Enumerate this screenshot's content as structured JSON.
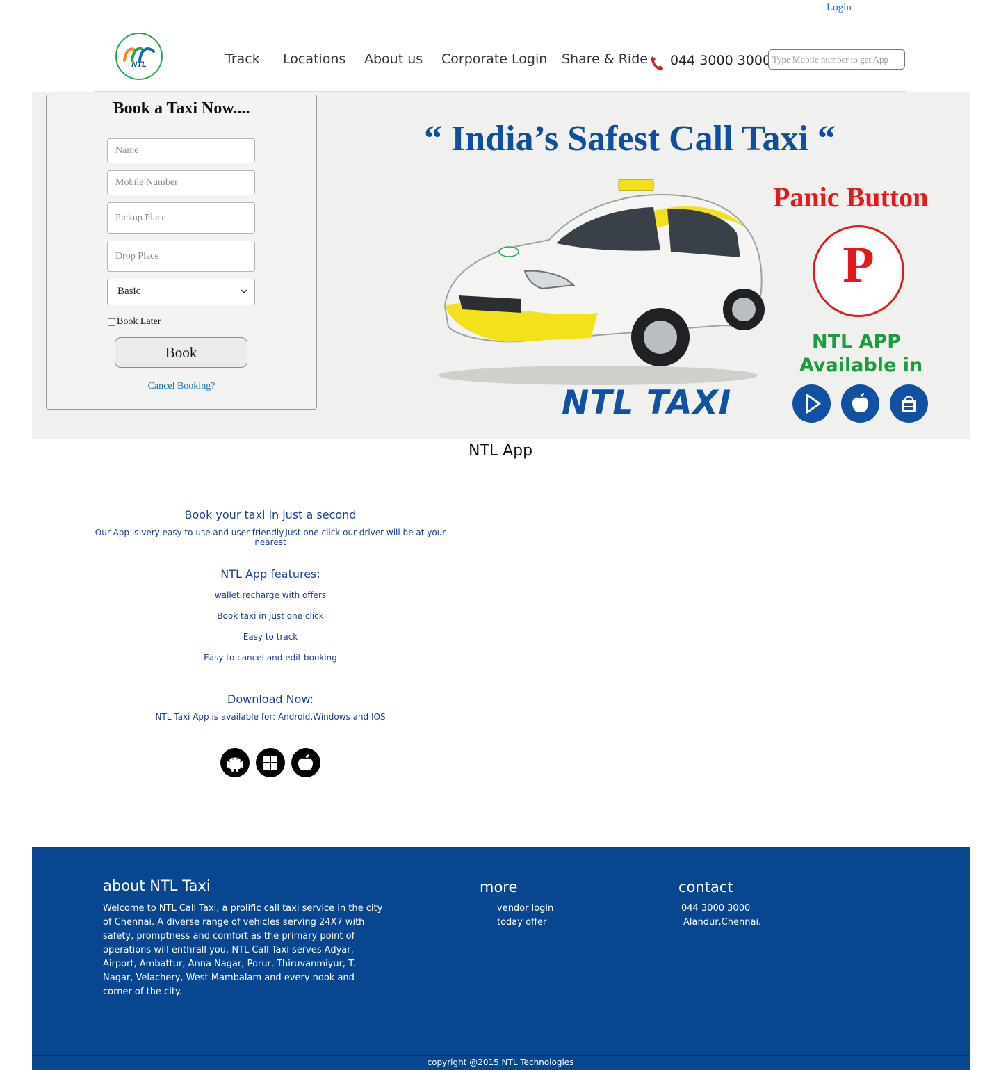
{
  "header": {
    "login_label": "Login",
    "logo_text": "NTL",
    "nav": [
      "Track",
      "Locations",
      "About us",
      "Corporate Login",
      "Share & Ride"
    ],
    "phone": "044 3000 3000",
    "app_input_placeholder": "Type Mobile number to get App"
  },
  "booking": {
    "title": "Book a Taxi Now....",
    "name_placeholder": "Name",
    "mobile_placeholder": "Mobile Number",
    "pickup_placeholder": "Pickup Place",
    "drop_placeholder": "Drop Place",
    "vehicle_selected": "Basic",
    "book_later_label": "Book Later",
    "book_later_checked": false,
    "book_button": "Book",
    "cancel_link": "Cancel Booking?"
  },
  "hero": {
    "tagline": "“ India’s Safest Call Taxi “",
    "brand": "NTL TAXI",
    "panic_title": "Panic Button",
    "panic_letter": "P",
    "app_line1": "NTL APP",
    "app_line2": "Available in",
    "stores": [
      "google-play-icon",
      "apple-icon",
      "windows-store-icon"
    ]
  },
  "app_section": {
    "heading": "NTL App",
    "book_heading": "Book your taxi in just a second",
    "book_text": "Our App is very easy to use and user friendly.Just one click our driver will be at your nearest",
    "features_heading": "NTL App features:",
    "features": [
      "wallet recharge with offers",
      "Book taxi in just one click",
      "Easy to track",
      "Easy to cancel and edit booking"
    ],
    "download_heading": "Download Now:",
    "download_text": "NTL Taxi App is available for: Android,Windows and IOS",
    "platforms": [
      "android-icon",
      "windows-icon",
      "apple-icon"
    ]
  },
  "footer": {
    "about_heading": "about NTL Taxi",
    "about_text": "Welcome to NTL Call Taxi, a prolific call taxi service in the city of Chennai. A diverse range of vehicles serving 24X7 with safety, promptness and comfort as the primary point of operations will enthrall you. NTL Call Taxi serves Adyar, Airport, Ambattur, Anna Nagar, Porur, Thiruvanmiyur, T. Nagar, Velachery, West Mambalam and every nook and corner of the city.",
    "more_heading": "more",
    "more_links": [
      "vendor login",
      "today offer"
    ],
    "contact_heading": "contact",
    "contact_phone": "044 3000 3000",
    "contact_address": "Alandur,Chennai.",
    "copyright": "copyright @2015 NTL Technologies"
  },
  "colors": {
    "brand_blue": "#114e9e",
    "footer_blue": "#08478f",
    "panic_red": "#e11a1a",
    "app_green": "#1d9c3f",
    "link_blue": "#1a73b8"
  }
}
